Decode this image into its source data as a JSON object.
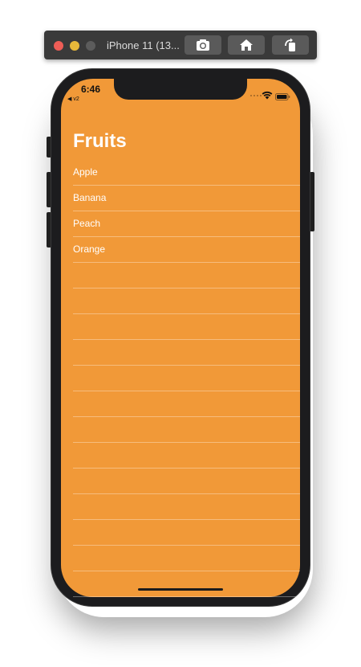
{
  "simulator": {
    "title": "iPhone 11 (13...",
    "buttons": [
      {
        "label": "",
        "icon": "screenshot-icon"
      },
      {
        "label": "",
        "icon": "home-icon"
      },
      {
        "label": "",
        "icon": "rotate-icon"
      }
    ]
  },
  "status_bar": {
    "time": "6:46",
    "back_app": "◀ v2"
  },
  "list": {
    "title": "Fruits",
    "items": [
      "Apple",
      "Banana",
      "Peach",
      "Orange"
    ],
    "empty_rows": 13
  },
  "colors": {
    "background": "#f19938",
    "text": "#ffffff",
    "separator": "rgba(255,255,255,0.35)"
  }
}
